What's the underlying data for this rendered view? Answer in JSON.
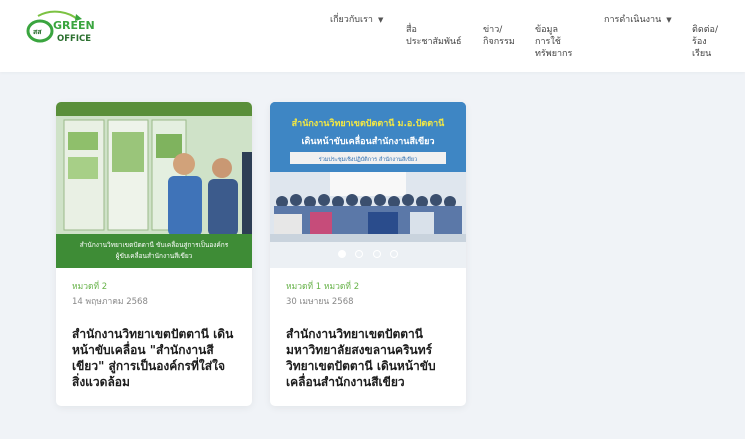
{
  "header": {
    "logo": {
      "prefix": "สส",
      "line1": "GREEN",
      "line2": "OFFICE"
    },
    "nav": [
      {
        "label": "เกี่ยวกับเรา",
        "has_dropdown": true
      },
      {
        "label": "สื่อ\nประชาสัมพันธ์",
        "has_dropdown": false
      },
      {
        "label": "ข่าว/\nกิจกรรม",
        "has_dropdown": false
      },
      {
        "label": "ข้อมูลการใช้\nทรัพยากร",
        "has_dropdown": false
      },
      {
        "label": "การดำเนินงาน",
        "has_dropdown": true
      },
      {
        "label": "ติดต่อ/\nร้อง\nเรียน",
        "has_dropdown": false
      }
    ]
  },
  "posts": [
    {
      "category": "หมวดที่ 2",
      "date": "14 พฤษภาคม 2568",
      "title": "สำนักงานวิทยาเขตปัตตานี เดินหน้าขับเคลื่อน \"สำนักงานสีเขียว\" สู่การเป็นองค์กรที่ใส่ใจสิ่งแวดล้อม",
      "image": {
        "caption_line1": "สำนักงานวิทยาเขตปัตตานี ขับเคลื่อนสู่การเป็นองค์กร",
        "caption_line2": "ผู้ขับเคลื่อนสำนักงานสีเขียว"
      }
    },
    {
      "category": "หมวดที่ 1 หมวดที่ 2",
      "date": "30 เมษายน 2568",
      "title": "สำนักงานวิทยาเขตปัตตานี มหาวิทยาลัยสงขลานครินทร์ วิทยาเขตปัตตานี เดินหน้าขับเคลื่อนสำนักงานสีเขียว",
      "image": {
        "heading_line1": "สำนักงานวิทยาเขตปัตตานี ม.อ.ปัตตานี",
        "heading_line2": "เดินหน้าขับเคลื่อนสำนักงานสีเขียว",
        "subheading": "ร่วมประชุมเชิงปฏิบัติการ สำนักงานสีเขียว"
      }
    }
  ],
  "colors": {
    "brand_green": "#3aa53f",
    "category_green": "#68b34a",
    "page_bg": "#f0f3f7"
  }
}
